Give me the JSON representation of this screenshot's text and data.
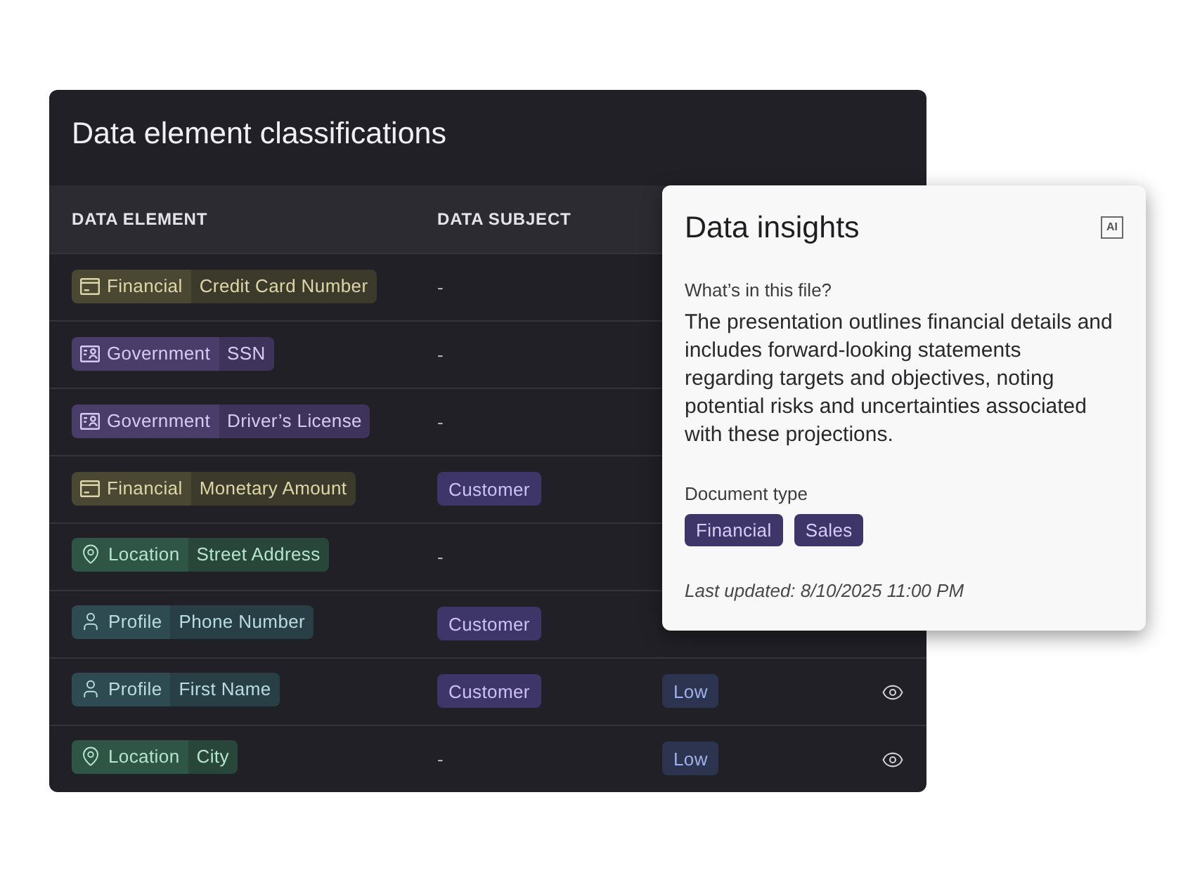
{
  "table": {
    "title": "Data element classifications",
    "columns": [
      "DATA ELEMENT",
      "DATA SUBJECT"
    ],
    "rows": [
      {
        "category": {
          "kind": "financial",
          "label": "Financial"
        },
        "element": "Credit Card Number",
        "subject": {
          "kind": "empty",
          "text": "-"
        }
      },
      {
        "category": {
          "kind": "government",
          "label": "Government"
        },
        "element": "SSN",
        "subject": {
          "kind": "empty",
          "text": "-"
        }
      },
      {
        "category": {
          "kind": "government",
          "label": "Government"
        },
        "element": "Driver’s License",
        "subject": {
          "kind": "empty",
          "text": "-"
        }
      },
      {
        "category": {
          "kind": "financial",
          "label": "Financial"
        },
        "element": "Monetary Amount",
        "subject": {
          "kind": "tag",
          "text": "Customer"
        }
      },
      {
        "category": {
          "kind": "location",
          "label": "Location"
        },
        "element": "Street Address",
        "subject": {
          "kind": "empty",
          "text": "-"
        }
      },
      {
        "category": {
          "kind": "profile",
          "label": "Profile"
        },
        "element": "Phone Number",
        "subject": {
          "kind": "tag",
          "text": "Customer"
        }
      },
      {
        "category": {
          "kind": "profile",
          "label": "Profile"
        },
        "element": "First Name",
        "subject": {
          "kind": "tag",
          "text": "Customer"
        },
        "sensitivity": "Low",
        "view_button": true
      },
      {
        "category": {
          "kind": "location",
          "label": "Location"
        },
        "element": "City",
        "subject": {
          "kind": "empty",
          "text": "-"
        },
        "sensitivity": "Low",
        "view_button": true
      }
    ]
  },
  "insights": {
    "title": "Data insights",
    "ai_tag": "AI",
    "question": "What’s in this file?",
    "summary": "The presentation outlines financial details and includes forward-looking statements regarding targets and objectives, noting potential risks and uncertainties associated with these projections.",
    "document_type_label": "Document type",
    "document_types": [
      "Financial",
      "Sales"
    ],
    "last_updated": "Last updated: 8/10/2025 11:00 PM"
  }
}
